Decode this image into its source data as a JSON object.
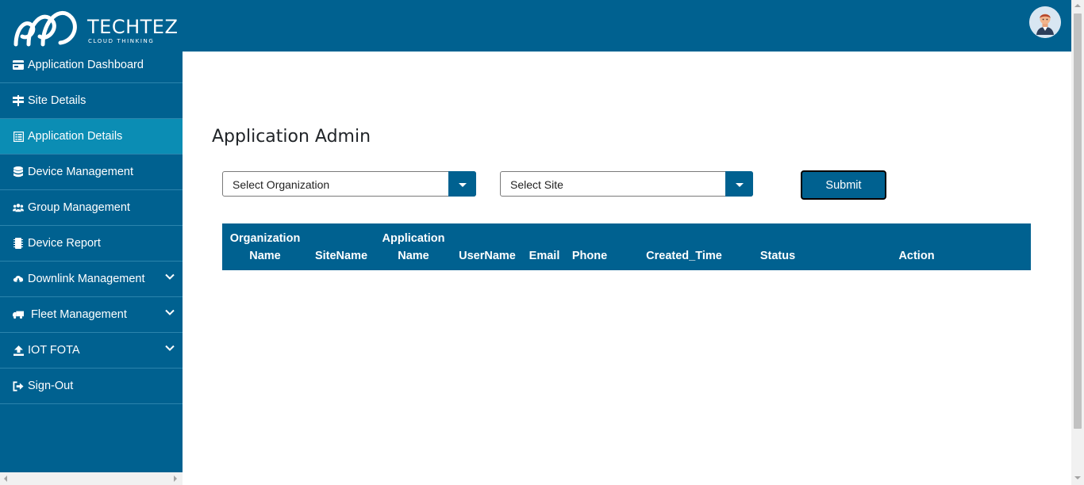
{
  "brand": {
    "name": "TECHTEZ",
    "tagline": "CLOUD THINKING"
  },
  "sidebar": {
    "items": [
      {
        "label": "Application Dashboard",
        "icon": "dashboard-card-icon"
      },
      {
        "label": "Site Details",
        "icon": "signpost-icon"
      },
      {
        "label": "Application Details",
        "icon": "list-alt-icon",
        "active": true
      },
      {
        "label": "Device Management",
        "icon": "database-icon"
      },
      {
        "label": "Group Management",
        "icon": "users-icon"
      },
      {
        "label": "Device Report",
        "icon": "chip-icon"
      },
      {
        "label": "Downlink Management",
        "icon": "cloud-download-icon",
        "expandable": true
      },
      {
        "label": "Fleet Management",
        "icon": "truck-icon",
        "expandable": true
      },
      {
        "label": "IOT FOTA",
        "icon": "upload-icon",
        "expandable": true
      },
      {
        "label": "Sign-Out",
        "icon": "sign-out-icon"
      }
    ]
  },
  "main": {
    "title": "Application Admin",
    "organization_select": {
      "value": "Select Organization"
    },
    "site_select": {
      "value": "Select Site"
    },
    "submit_label": "Submit",
    "table": {
      "headers": [
        [
          "Organization",
          "Name"
        ],
        [
          "",
          "SiteName"
        ],
        [
          "Application",
          "Name"
        ],
        [
          "",
          "UserName"
        ],
        [
          "",
          "Email"
        ],
        [
          "",
          "Phone"
        ],
        [
          "",
          "Created_Time"
        ],
        [
          "",
          "Status"
        ],
        [
          "",
          "Action"
        ]
      ]
    }
  },
  "colors": {
    "primary": "#006190",
    "active": "#0b8db4",
    "divider": "#2b84ad"
  }
}
